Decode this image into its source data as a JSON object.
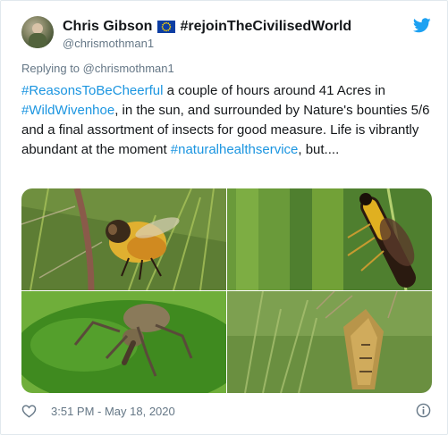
{
  "author": {
    "name": "Chris Gibson",
    "flag_icon": "eu-flag-icon",
    "display_suffix": "#rejoinTheCivilisedWorld",
    "handle": "@chrismothman1"
  },
  "reply": {
    "prefix": "Replying to",
    "target": "@chrismothman1"
  },
  "tweet": {
    "segments": [
      {
        "text": "#ReasonsToBeCheerful",
        "type": "hashtag"
      },
      {
        "text": " a couple of hours around 41 Acres in ",
        "type": "text"
      },
      {
        "text": "#WildWivenhoe",
        "type": "hashtag"
      },
      {
        "text": ", in the sun, and surrounded by Nature's bounties 5/6 and a final assortment of insects for good measure. Life is vibrantly abundant at the moment ",
        "type": "text"
      },
      {
        "text": "#naturalhealthservice",
        "type": "hashtag"
      },
      {
        "text": ", but....",
        "type": "text"
      }
    ]
  },
  "media": {
    "photos": [
      {
        "subject": "hoverfly on grass"
      },
      {
        "subject": "sawfly on grass stem"
      },
      {
        "subject": "weevil on leaf"
      },
      {
        "subject": "shieldbug on grass seedhead"
      }
    ]
  },
  "footer": {
    "time": "3:51 PM - May 18, 2020"
  },
  "icons": {
    "brand": "twitter-bird-icon",
    "like": "heart-icon",
    "info": "info-icon"
  },
  "colors": {
    "link": "#1b95e0",
    "muted": "#657786",
    "text": "#14171a",
    "twitter_blue": "#1da1f2"
  }
}
